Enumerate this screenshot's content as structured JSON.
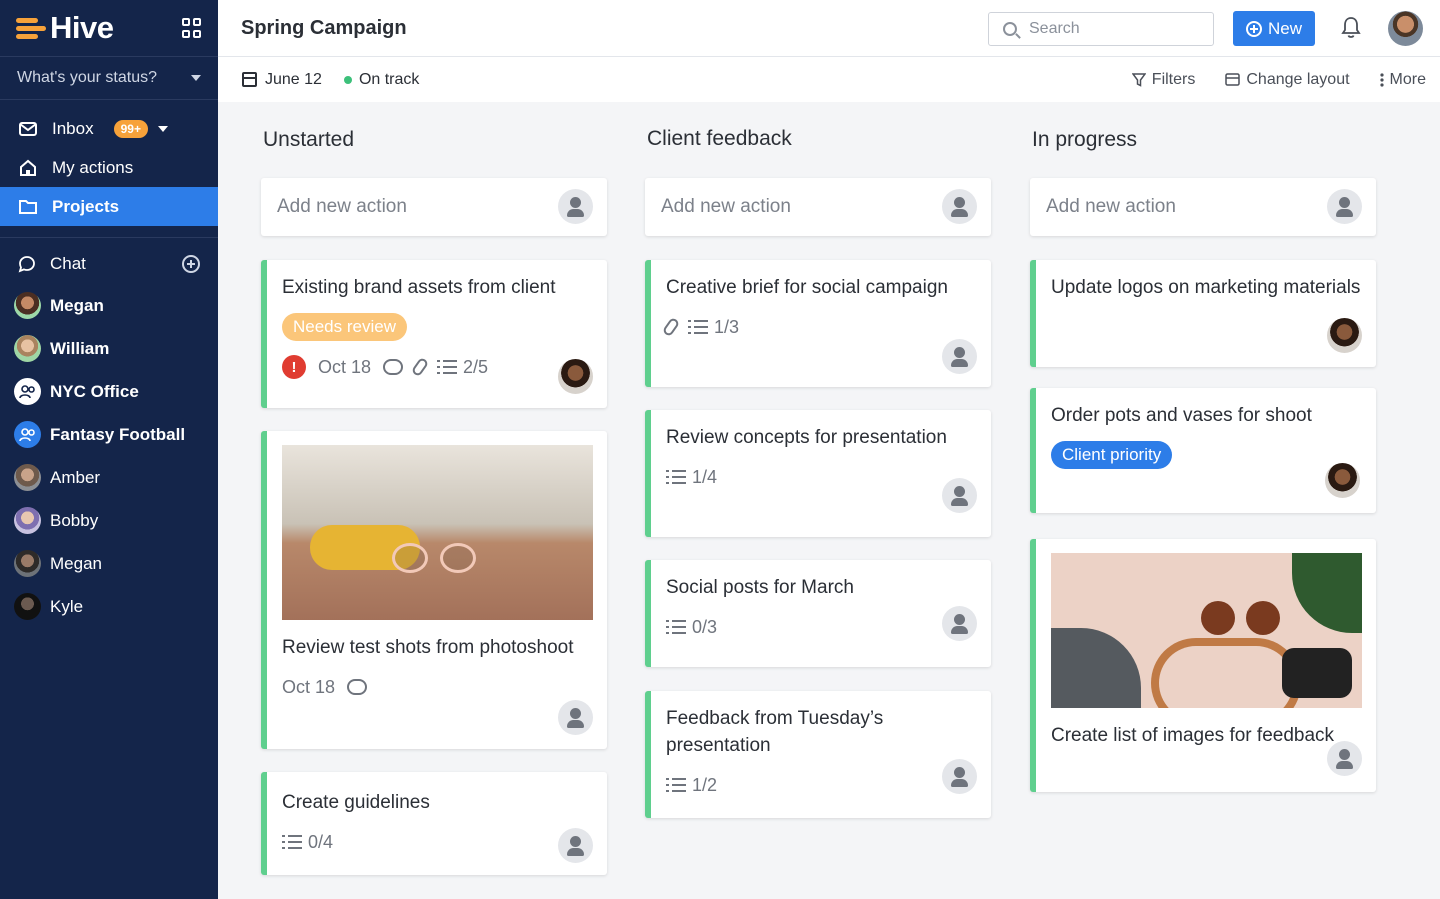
{
  "sidebar": {
    "brand": "Hive",
    "status_prompt": "What's your status?",
    "nav": [
      {
        "label": "Inbox",
        "badge": "99+"
      },
      {
        "label": "My actions"
      },
      {
        "label": "Projects"
      }
    ],
    "chat_label": "Chat",
    "chats": [
      {
        "label": "Megan",
        "bold": true,
        "color": "#6a4636"
      },
      {
        "label": "William",
        "bold": true,
        "color": "#9ab0a0"
      },
      {
        "label": "NYC Office",
        "bold": true,
        "color": "#ffffff"
      },
      {
        "label": "Fantasy Football",
        "bold": true,
        "color": "#2d7de8"
      },
      {
        "label": "Amber",
        "bold": false,
        "color": "#6e6a66"
      },
      {
        "label": "Bobby",
        "bold": false,
        "color": "#8c80b5"
      },
      {
        "label": "Megan",
        "bold": false,
        "color": "#4a4f55"
      },
      {
        "label": "Kyle",
        "bold": false,
        "color": "#222326"
      }
    ]
  },
  "topbar": {
    "title": "Spring Campaign",
    "search_placeholder": "Search",
    "new_label": "New"
  },
  "subbar": {
    "date": "June 12",
    "status": "On track",
    "filters": "Filters",
    "change_layout": "Change layout",
    "more": "More"
  },
  "columns": [
    {
      "title": "Unstarted",
      "add_placeholder": "Add new action",
      "cards": [
        {
          "title": "Existing brand assets from client",
          "tag": "Needs review",
          "date": "Oct 18",
          "checklist": "2/5"
        },
        {
          "title": "Review test shots from photoshoot",
          "date": "Oct 18"
        },
        {
          "title": "Create guidelines",
          "checklist": "0/4"
        }
      ]
    },
    {
      "title": "Client feedback",
      "add_placeholder": "Add new action",
      "cards": [
        {
          "title": "Creative brief for social campaign",
          "checklist": "1/3"
        },
        {
          "title": "Review concepts for presentation",
          "checklist": "1/4"
        },
        {
          "title": "Social posts for March",
          "checklist": "0/3"
        },
        {
          "title": "Feedback from Tuesday’s presentation",
          "checklist": "1/2"
        }
      ]
    },
    {
      "title": "In progress",
      "add_placeholder": "Add new action",
      "cards": [
        {
          "title": "Update logos on marketing materials"
        },
        {
          "title": "Order pots and vases for shoot",
          "tag": "Client priority"
        },
        {
          "title": "Create list of images for feedback"
        }
      ]
    }
  ]
}
